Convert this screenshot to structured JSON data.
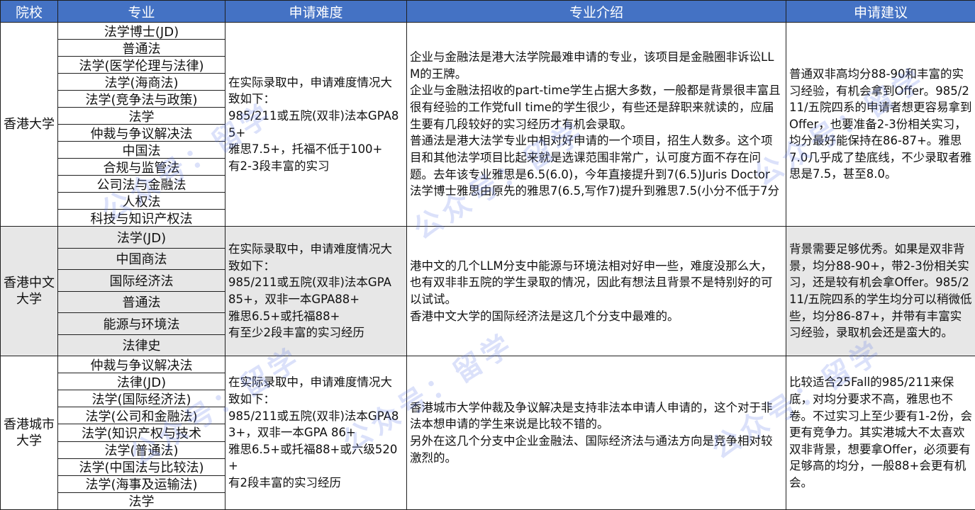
{
  "headers": [
    "院校",
    "专业",
    "申请难度",
    "专业介绍",
    "申请建议"
  ],
  "watermark": "公众号：留学",
  "rows": [
    {
      "school": "香港大学",
      "majors": [
        "法学博士(JD)",
        "普通法",
        "法学(医学伦理与法律)",
        "法学(海商法)",
        "法学(竞争法与政策)",
        "法学",
        "仲裁与争议解决法",
        "中国法",
        "合规与监管法",
        "公司法与金融法",
        "人权法",
        "科技与知识产权法"
      ],
      "difficulty": "在实际录取中，申请难度情况大致如下：\n985/211或五院(双非)法本GPA85+\n雅思7.5+，托福不低于100+\n有2-3段丰富的实习",
      "intro": "企业与金融法是港大法学院最难申请的专业，该项目是金融圈非诉讼LLM的王牌。\n企业与金融法招收的part-time学生占据大多数，一般都是背景很丰富且很有经验的工作党full time的学生很少，有些还是辞职来就读的，应届生要有几段较好的实习经历才有机会录取。\n普通法是港大法学专业中相对好申请的一个项目，招生人数多。这个项目和其他法学项目比起来就是选课范围非常广，认可度方面不存在问题。去年该专业雅思是6.5(6.0)，今年直接提升到7(6.5)Juris Doctor 法学博士雅思由原先的雅思7(6.5,写作7)提升到雅思7.5(小分不低于7分",
      "advice": "普通双非高均分88-90和丰富的实习经验，有机会拿到Offer。985/211/五院四系的申请者想更容易拿到Offer，也要准备2-3份相关实习，均分最好能保持在86-87+。雅思7.0几乎成了垫底线，不少录取者雅思是7.5，甚至8.0。"
    },
    {
      "school": "香港中文大学",
      "majors": [
        "法学(JD)",
        "中国商法",
        "国际经济法",
        "普通法",
        "能源与环境法",
        "法律史"
      ],
      "difficulty": "在实际录取中，申请难度情况大致如下：\n985/211或五院(双非)法本GPA\n85+，双非一本GPA88+\n雅思6.5+或托福88+\n有至少2段丰富的实习经历",
      "intro": "港中文的几个LLM分支中能源与环境法相对好申一些，难度没那么大，也有双非非五院的学生录取的情况，因此有想法且背景不是特别好的可以试试。\n香港中文大学的国际经济法是这几个分支中最难的。",
      "advice": "背景需要足够优秀。如果是双非背景，均分88-90+，带2-3份相关实习，还是较有机会拿Offer。985/211/五院四系的学生均分可以稍微低些，均分86-87+，并带有丰富实习经验，录取机会还是蛮大的。"
    },
    {
      "school": "香港城市大学",
      "majors": [
        "仲裁与争议解决法",
        "法律(JD)",
        "法学(国际经济法)",
        "法学(公司和金融法)",
        "法学(知识产权与技术",
        "法学(普通法)",
        "法学(中国法与比较法)",
        "法学(海事及运输法)",
        "法学"
      ],
      "difficulty": "在实际录取中，申请难度情况大致如下：\n985/211或五院(双非)法本GPA83+，双非一本GPA 86+\n雅思6.5+或托福88+或六级520+\n有2段丰富的实习经历",
      "intro": "香港城市大学仲裁及争议解决是支持非法本申请人申请的，这个对于非法本想申请的学生来说是比较不错的。\n另外在这几个分支中企业金融法、国际经济法与通法方向是竞争相对较激烈的。",
      "advice": "比较适合25Fall的985/211来保底，对均分要求不高，雅思也不卷。不过实习上至少要有1-2份，会更有竞争力。其实港城大不太喜欢双非背景，想要拿Offer，必须要有足够高的均分，一般88+会更有机会。"
    }
  ]
}
